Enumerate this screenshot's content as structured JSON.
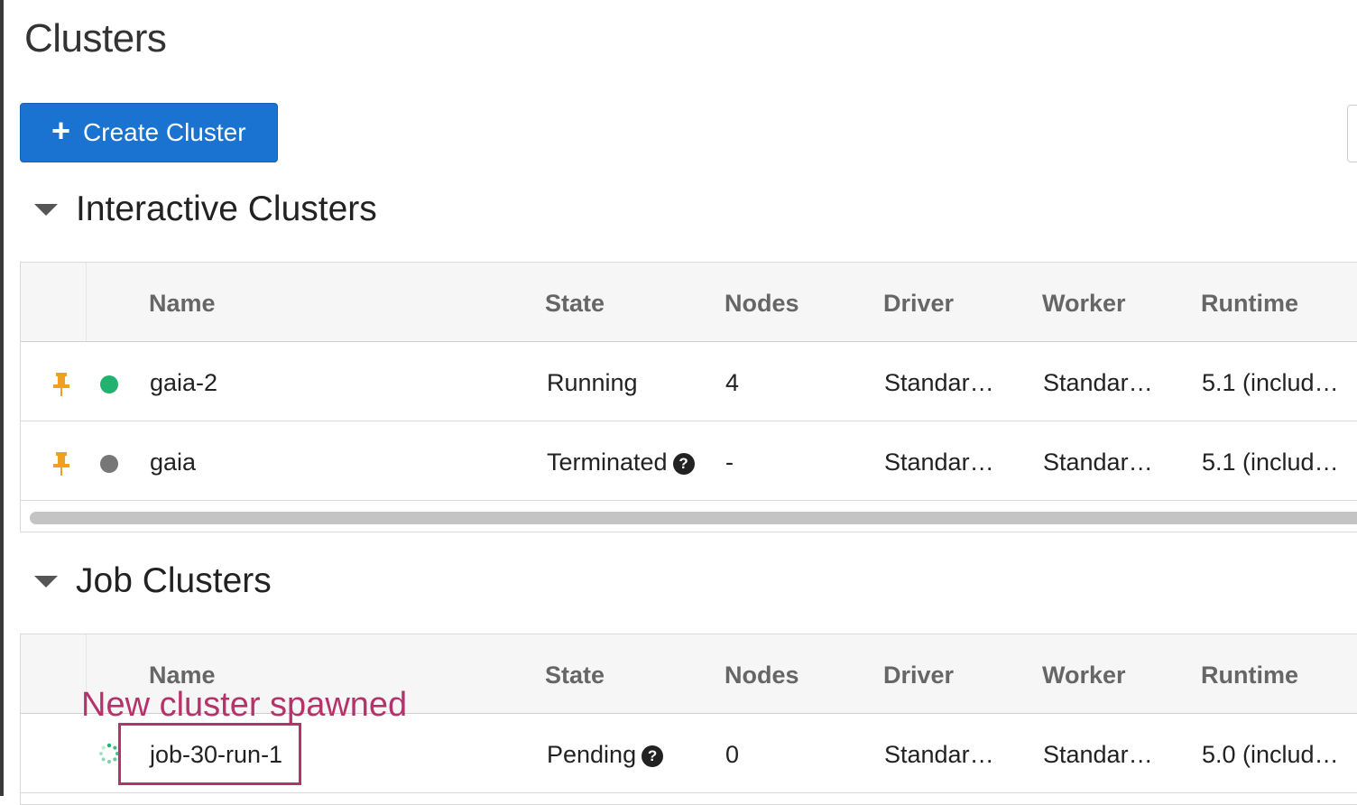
{
  "page": {
    "title": "Clusters"
  },
  "toolbar": {
    "create_icon": "+",
    "create_label": "Create Cluster"
  },
  "interactive": {
    "title": "Interactive Clusters",
    "columns": [
      "Name",
      "State",
      "Nodes",
      "Driver",
      "Worker",
      "Runtime"
    ],
    "rows": [
      {
        "name": "gaia-2",
        "state": "Running",
        "status": "running",
        "status_color": "#21b26f",
        "nodes": "4",
        "driver": "Standar…",
        "worker": "Standar…",
        "runtime": "5.1 (includ…"
      },
      {
        "name": "gaia",
        "state": "Terminated",
        "status": "terminated",
        "status_color": "#777777",
        "nodes": "-",
        "driver": "Standar…",
        "worker": "Standar…",
        "runtime": "5.1 (includ…"
      }
    ]
  },
  "job": {
    "title": "Job Clusters",
    "columns": [
      "Name",
      "State",
      "Nodes",
      "Driver",
      "Worker",
      "Runtime"
    ],
    "rows": [
      {
        "name": "job-30-run-1",
        "state": "Pending",
        "status": "pending",
        "status_color": "#21b26f",
        "nodes": "0",
        "driver": "Standar…",
        "worker": "Standar…",
        "runtime": "5.0 (includ…"
      }
    ]
  },
  "annotation": {
    "text": "New cluster spawned",
    "color": "#b5326b"
  },
  "icons": {
    "help": "?",
    "pin_color": "#f0a020"
  },
  "colors": {
    "primary_button": "#1a73d1"
  }
}
